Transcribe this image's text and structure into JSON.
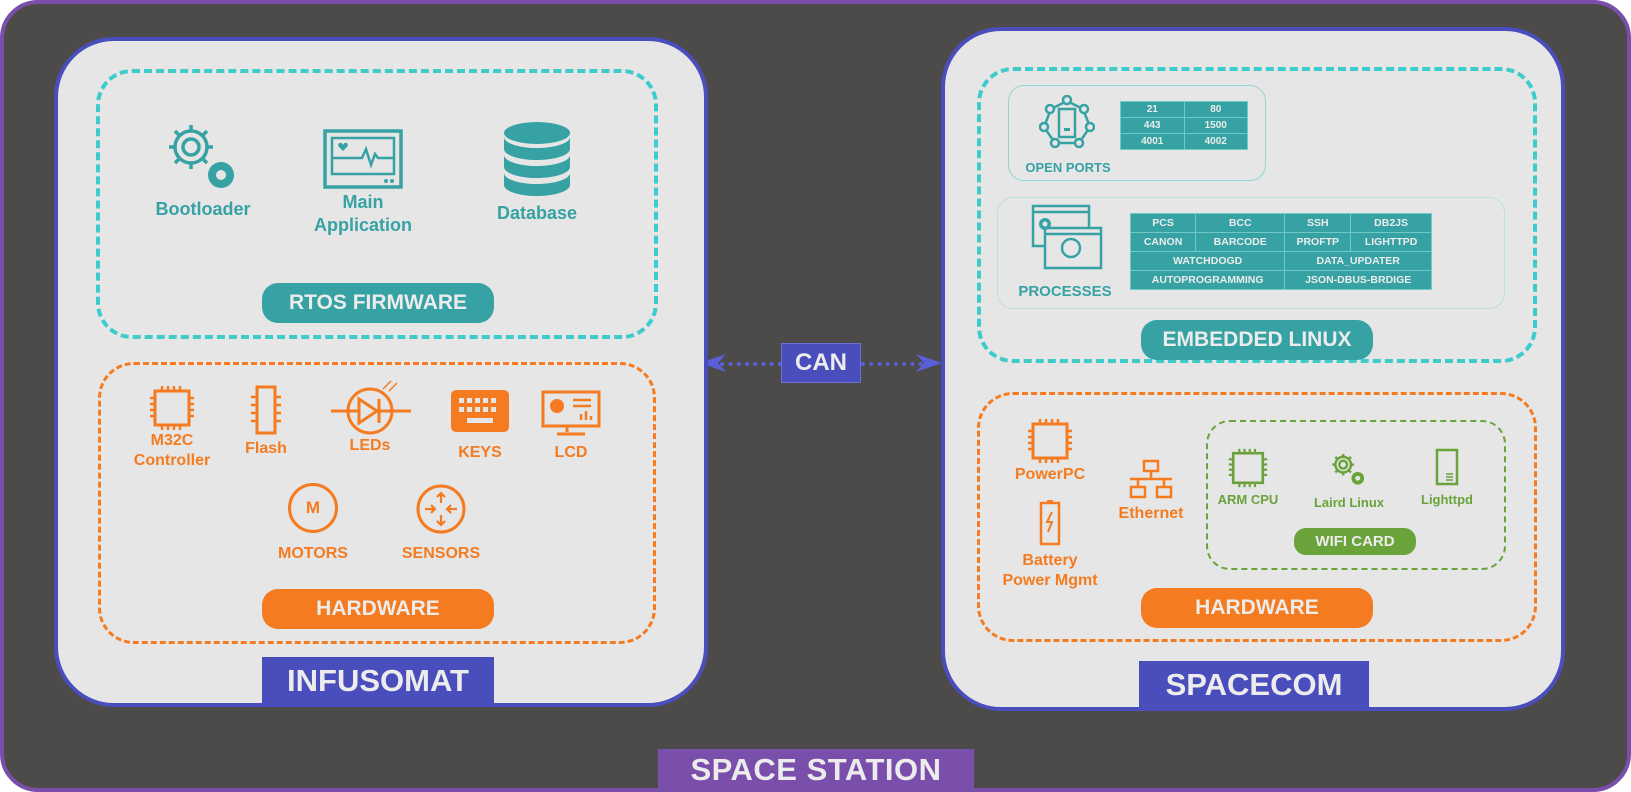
{
  "colors": {
    "background": "#4d4b4a",
    "station_border": "#7a4fab",
    "device_border": "#4a4ebc",
    "panel_fill": "#e6e6e6",
    "teal": "#37a2a4",
    "teal_dash": "#3ecbcb",
    "orange": "#f47b20",
    "green": "#6aa33a",
    "label_text": "#ececec"
  },
  "station": {
    "label": "SPACE STATION"
  },
  "link": {
    "label": "CAN"
  },
  "infusomat": {
    "label": "INFUSOMAT",
    "firmware": {
      "label": "RTOS FIRMWARE",
      "items": [
        {
          "icon": "gears-icon",
          "label": "Bootloader"
        },
        {
          "icon": "monitor-heartbeat-icon",
          "label_line1": "Main",
          "label_line2": "Application"
        },
        {
          "icon": "database-icon",
          "label": "Database"
        }
      ]
    },
    "hardware": {
      "label": "HARDWARE",
      "items": [
        {
          "icon": "chip-icon",
          "label_line1": "M32C",
          "label_line2": "Controller"
        },
        {
          "icon": "flash-chip-icon",
          "label": "Flash"
        },
        {
          "icon": "led-diode-icon",
          "label": "LEDs"
        },
        {
          "icon": "keyboard-icon",
          "label": "KEYS"
        },
        {
          "icon": "lcd-monitor-icon",
          "label": "LCD"
        },
        {
          "icon": "motor-icon",
          "label": "MOTORS",
          "glyph": "M"
        },
        {
          "icon": "sensor-arrows-icon",
          "label": "SENSORS"
        }
      ]
    }
  },
  "spacecom": {
    "label": "SPACECOM",
    "linux": {
      "label": "EMBEDDED LINUX",
      "open_ports": {
        "label": "OPEN PORTS",
        "icon": "network-device-icon",
        "rows": [
          [
            "21",
            "80"
          ],
          [
            "443",
            "1500"
          ],
          [
            "4001",
            "4002"
          ]
        ]
      },
      "processes": {
        "label": "PROCESSES",
        "icon": "windows-gears-icon",
        "rows4": [
          [
            "PCS",
            "BCC",
            "SSH",
            "DB2JS"
          ],
          [
            "CANON",
            "BARCODE",
            "PROFTP",
            "LIGHTTPD"
          ]
        ],
        "rows2": [
          [
            "WATCHDOGD",
            "DATA_UPDATER"
          ],
          [
            "AUTOPROGRAMMING",
            "JSON-DBUS-BRDIGE"
          ]
        ]
      }
    },
    "hardware": {
      "label": "HARDWARE",
      "items": [
        {
          "icon": "chip-icon",
          "label": "PowerPC"
        },
        {
          "icon": "battery-icon",
          "label_line1": "Battery",
          "label_line2": "Power Mgmt"
        },
        {
          "icon": "ethernet-icon",
          "label": "Ethernet"
        }
      ],
      "wifi": {
        "label": "WIFI CARD",
        "items": [
          {
            "icon": "chip-icon",
            "label": "ARM CPU"
          },
          {
            "icon": "gears-icon",
            "label": "Laird Linux"
          },
          {
            "icon": "server-icon",
            "label": "Lighttpd"
          }
        ]
      }
    }
  }
}
